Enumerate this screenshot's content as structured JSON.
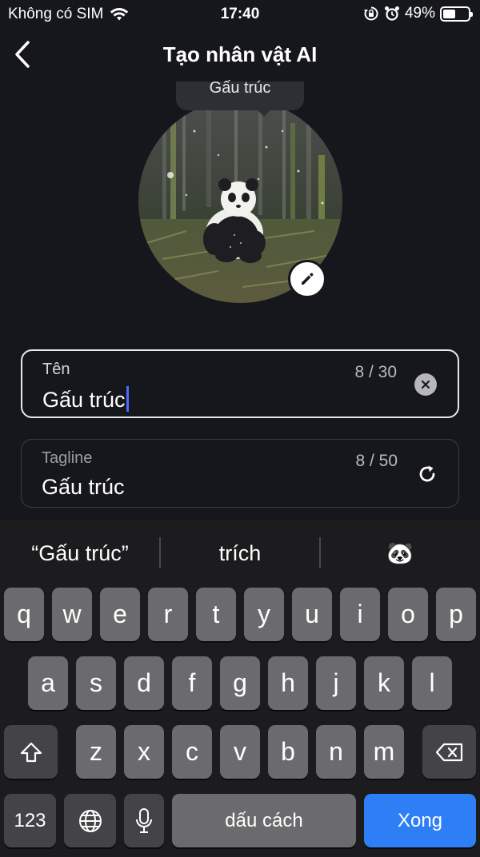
{
  "status_bar": {
    "carrier": "Không có SIM",
    "time": "17:40",
    "battery_percent": "49%",
    "battery_level": 0.49,
    "icons": [
      "wifi-icon",
      "orientation-lock-icon",
      "alarm-icon",
      "battery-icon"
    ]
  },
  "header": {
    "title": "Tạo nhân vật AI",
    "back_icon": "chevron-left-icon"
  },
  "avatar": {
    "tooltip": "Gấu trúc",
    "edit_icon": "pencil-icon"
  },
  "name_field": {
    "label": "Tên",
    "value": "Gấu trúc",
    "count": "8 / 30",
    "clear_icon": "clear-icon"
  },
  "tagline_field": {
    "label": "Tagline",
    "value": "Gấu trúc",
    "count": "8 / 50",
    "refresh_icon": "refresh-icon"
  },
  "keyboard": {
    "suggestions": [
      "“Gấu trúc”",
      "trích",
      "🐼"
    ],
    "row1": [
      "q",
      "w",
      "e",
      "r",
      "t",
      "y",
      "u",
      "i",
      "o",
      "p"
    ],
    "row2": [
      "a",
      "s",
      "d",
      "f",
      "g",
      "h",
      "j",
      "k",
      "l"
    ],
    "row3": [
      "z",
      "x",
      "c",
      "v",
      "b",
      "n",
      "m"
    ],
    "numbers_key": "123",
    "space_key": "dấu cách",
    "done_key": "Xong",
    "accent_color": "#2e7ff5"
  },
  "colors": {
    "background": "#16171c",
    "cursor": "#4a6cff"
  }
}
